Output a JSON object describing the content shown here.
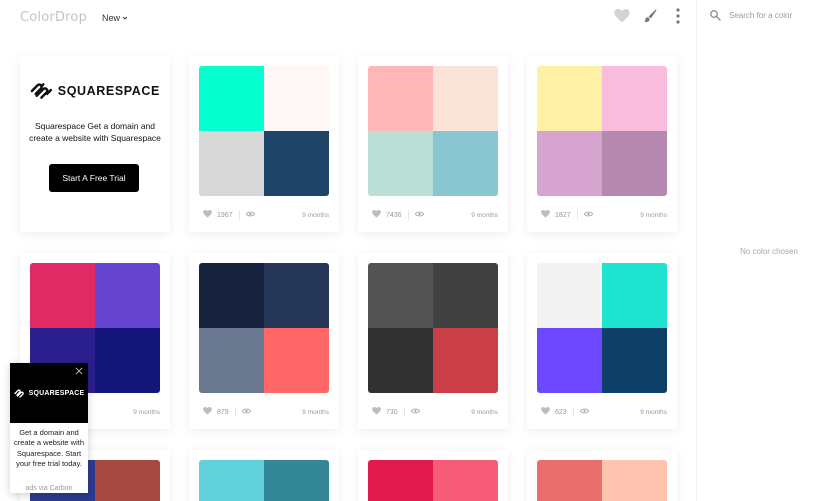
{
  "header": {
    "brand": "ColorDrop",
    "filter_label": "New",
    "icons": [
      "heart-icon",
      "brush-icon",
      "more-vertical-icon"
    ]
  },
  "search": {
    "placeholder": "Search for a color"
  },
  "panel": {
    "empty_text": "No color chosen"
  },
  "sponsor": {
    "brand": "SQUARESPACE",
    "text": "Squarespace Get a domain and create a website with Squarespace",
    "button_label": "Start A Free Trial"
  },
  "carbon": {
    "brand": "SQUARESPACE",
    "text": "Get a domain and create a website with Squarespace. Start your free trial today.",
    "via": "ads via Carbon"
  },
  "palettes": [
    {
      "colors": [
        "#05ffcf",
        "#fff6f6",
        "#d8d8d8",
        "#1e4468"
      ],
      "likes": "1967",
      "age": "9 months"
    },
    {
      "colors": [
        "#ffb6b9",
        "#fae3d9",
        "#bbded6",
        "#8ac6d1"
      ],
      "likes": "7436",
      "age": "9 months"
    },
    {
      "colors": [
        "#fef0a5",
        "#f9bcdd",
        "#d5a4cf",
        "#b689b0"
      ],
      "likes": "1827",
      "age": "9 months"
    },
    {
      "colors": [
        "#e02a66",
        "#6645d1",
        "#2b1f8e",
        "#13177a"
      ],
      "likes": "",
      "age": "9 months"
    },
    {
      "colors": [
        "#182340",
        "#263659",
        "#6a788f",
        "#ff6665"
      ],
      "likes": "879",
      "age": "9 months"
    },
    {
      "colors": [
        "#535353",
        "#414141",
        "#313131",
        "#ca3e47"
      ],
      "likes": "730",
      "age": "9 months"
    },
    {
      "colors": [
        "#f3f3f3",
        "#1ee3cf",
        "#6b48ff",
        "#0d3f67"
      ],
      "likes": "623",
      "age": "9 months"
    },
    {
      "colors": [
        "#2d3a8f",
        "#a6483f"
      ],
      "likes": "",
      "age": ""
    },
    {
      "colors": [
        "#61d2dc",
        "#338797"
      ],
      "likes": "",
      "age": ""
    },
    {
      "colors": [
        "#e31a4d",
        "#f65c78"
      ],
      "likes": "",
      "age": ""
    },
    {
      "colors": [
        "#ea6e6b",
        "#ffc3b0"
      ],
      "likes": "",
      "age": ""
    }
  ]
}
